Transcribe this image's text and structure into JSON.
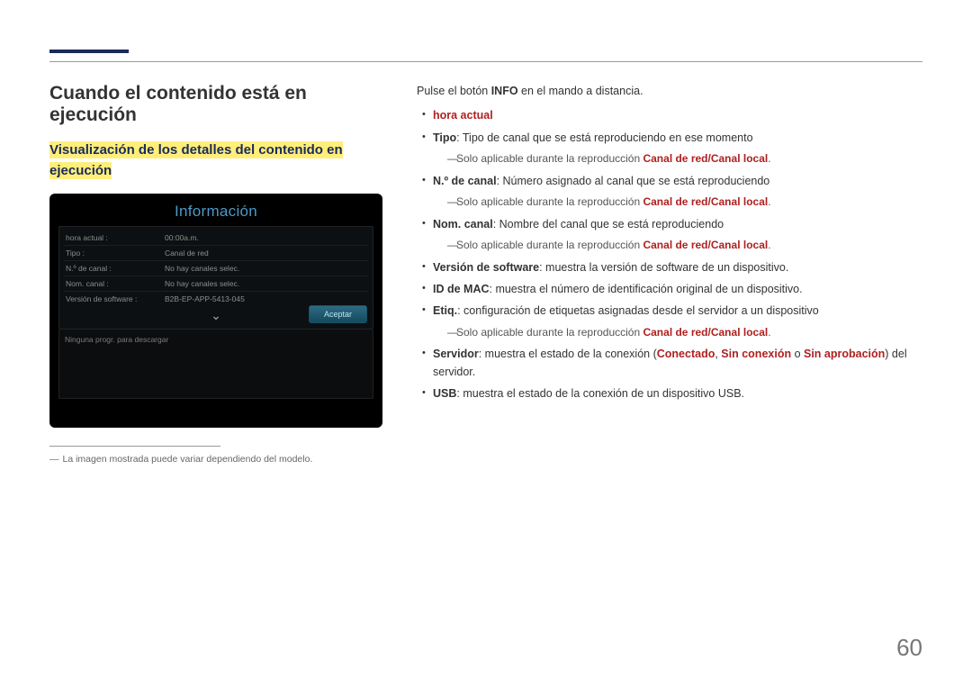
{
  "page_number": "60",
  "heading": "Cuando el contenido está en ejecución",
  "subheading": "Visualización de los detalles del contenido en ejecución",
  "screenshot": {
    "title": "Información",
    "rows": [
      {
        "label": "hora actual :",
        "value": "00:00a.m."
      },
      {
        "label": "Tipo :",
        "value": "Canal de red"
      },
      {
        "label": "N.º de canal :",
        "value": "No hay canales selec."
      },
      {
        "label": "Nom. canal :",
        "value": "No hay canales selec."
      },
      {
        "label": "Versión de software :",
        "value": "B2B-EP-APP-5413-045"
      }
    ],
    "accept": "Aceptar",
    "lower_note": "Ninguna progr. para descargar"
  },
  "footnote": "La imagen mostrada puede variar dependiendo del modelo.",
  "right": {
    "intro_pre": "Pulse el botón ",
    "intro_bold": "INFO",
    "intro_post": " en el mando a distancia.",
    "hora": "hora actual",
    "tipo_bold": "Tipo",
    "tipo_text": ": Tipo de canal que se está reproduciendo en ese momento",
    "sub_apply_pre": "Solo aplicable durante la reproducción ",
    "canal_red": "Canal de red",
    "slash": "/",
    "canal_local": "Canal local",
    "dot": ".",
    "ncanal_bold": "N.º de canal",
    "ncanal_text": ": Número asignado al canal que se está reproduciendo",
    "nom_bold": "Nom. canal",
    "nom_text": ": Nombre del canal que se está reproduciendo",
    "ver_bold": "Versión de software",
    "ver_text": ": muestra la versión de software de un dispositivo.",
    "mac_bold": "ID de MAC",
    "mac_text": ": muestra el número de identificación original de un dispositivo.",
    "etiq_bold": "Etiq.",
    "etiq_text": ": configuración de etiquetas asignadas desde el servidor a un dispositivo",
    "serv_bold": "Servidor",
    "serv_pre": ": muestra el estado de la conexión (",
    "conectado": "Conectado",
    "comma": ", ",
    "sin_con": "Sin conexión",
    "o": " o ",
    "sin_aprob": "Sin aprobación",
    "serv_post": ") del servidor.",
    "usb_bold": "USB",
    "usb_text": ": muestra el estado de la conexión de un dispositivo USB."
  }
}
